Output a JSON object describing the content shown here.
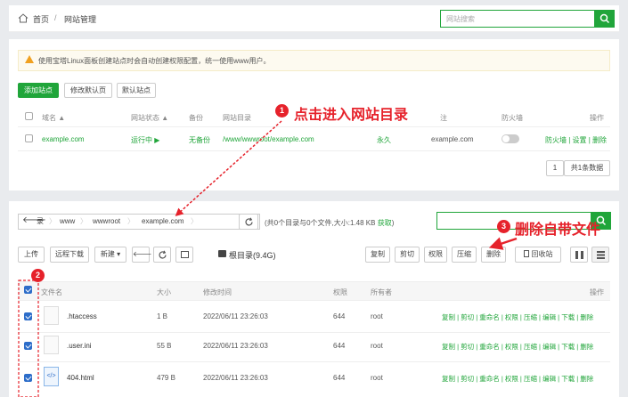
{
  "breadcrumb": {
    "home": "首页",
    "sep": "/",
    "current": "网站管理"
  },
  "search": {
    "placeholder": "网站搜索"
  },
  "notice": "使用宝塔Linux面板创建站点时会自动创建权限配置，统一使用www用户。",
  "site_toolbar": {
    "add": "添加站点",
    "edit_default_page": "修改默认页",
    "default_site": "默认站点"
  },
  "site_table": {
    "headers": {
      "name": "域名 ▲",
      "status": "网站状态 ▲",
      "backup": "备份",
      "dir": "网站目录",
      "expire": "到",
      "remark": "注",
      "firewall": "防火墙",
      "ops": "操作"
    },
    "row": {
      "name": "example.com",
      "status": "运行中 ▶",
      "backup": "无备份",
      "dir": "/www/wwwroot/example.com",
      "expire": "永久",
      "remark": "example.com",
      "ops": "防火墙 | 设置 | 删除"
    }
  },
  "pagination": {
    "page": "1",
    "total": "共1条数据"
  },
  "annotations": {
    "a1": "点击进入网站目录",
    "a2_num": "2",
    "a1_num": "1",
    "a3": "删除自带文件",
    "a3_num": "3"
  },
  "path_bar": {
    "seg0": "录",
    "seg1": "www",
    "seg2": "wwwroot",
    "seg3": "example.com",
    "info": "(共0个目录与0个文件,大小:1.48 KB ",
    "info_link": "获取",
    "info_end": ")"
  },
  "file_toolbar": {
    "upload": "上传",
    "remote": "远程下载",
    "new": "新建 ▾",
    "root": "根目录(9.4G)",
    "copy": "复制",
    "cut": "剪切",
    "perm": "权限",
    "compress": "压缩",
    "delete": "删除",
    "recycle": "回收站"
  },
  "file_table": {
    "headers": {
      "name": "文件名",
      "size": "大小",
      "mtime": "修改时间",
      "perm": "权限",
      "owner": "所有者",
      "ops": "操作"
    },
    "rows": [
      {
        "name": ".htaccess",
        "size": "1 B",
        "mtime": "2022/06/11 23:26:03",
        "perm": "644",
        "owner": "root",
        "ops": "复制 | 剪切 | 重命名 | 权限 | 压缩 | 编辑 | 下载 | 删除"
      },
      {
        "name": ".user.ini",
        "size": "55 B",
        "mtime": "2022/06/11 23:26:03",
        "perm": "644",
        "owner": "root",
        "ops": "复制 | 剪切 | 重命名 | 权限 | 压缩 | 编辑 | 下载 | 删除"
      },
      {
        "name": "404.html",
        "size": "479 B",
        "mtime": "2022/06/11 23:26:03",
        "perm": "644",
        "owner": "root",
        "ops": "复制 | 剪切 | 重命名 | 权限 | 压缩 | 编辑 | 下载 | 删除"
      }
    ]
  },
  "colors": {
    "accent": "#20a53a",
    "annotation": "#e6222b",
    "checkbox": "#2d6dc9"
  }
}
